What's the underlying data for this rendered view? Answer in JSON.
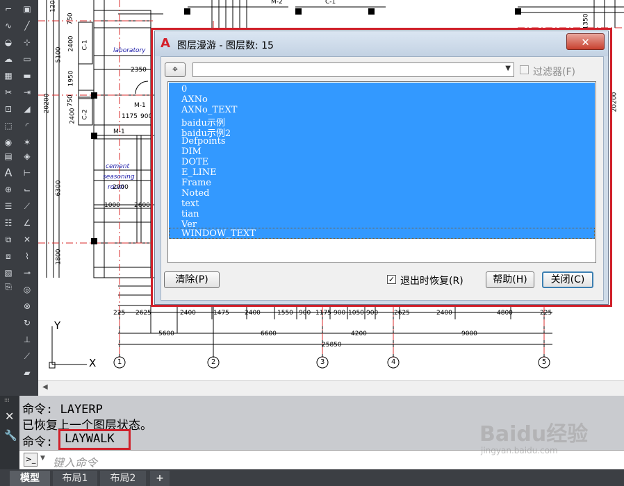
{
  "dialog": {
    "title": "图层漫游 - 图层数: 15",
    "close_glyph": "✕",
    "filter_label": "过滤器(F)",
    "filter_checked": false,
    "layers": [
      "0",
      "AXNo",
      "AXNo_TEXT",
      "baidu示例",
      "baidu示例2",
      "Defpoints",
      "DIM",
      "DOTE",
      "E_LINE",
      "Frame",
      "Noted",
      "text",
      "tian",
      "Ver",
      "WINDOW_TEXT"
    ],
    "clear_button": "清除(P)",
    "restore_label": "退出时恢复(R)",
    "restore_checked": true,
    "help_button": "帮助(H)",
    "close_button": "关闭(C)",
    "selection_color": "#3399ff"
  },
  "command": {
    "line1": "命令: LAYERP",
    "line2": "已恢复上一个图层状态。",
    "line3_prefix": "命令:",
    "line3_cmd": "LAYWALK",
    "input_placeholder": "键入命令"
  },
  "tabs": [
    "模型",
    "布局1",
    "布局2",
    "+"
  ],
  "drawing": {
    "room_labels": [
      "laboratory",
      "cement",
      "seasoning",
      "room"
    ],
    "door_labels": [
      "M-1",
      "M-1",
      "M-2",
      "C-1",
      "C-1",
      "C-2"
    ],
    "dims_left": [
      "120",
      "750",
      "2400",
      "5100",
      "1950",
      "20200",
      "750",
      "2400",
      "6300",
      "1800"
    ],
    "dims_small": [
      "2350",
      "1175",
      "900",
      "1000",
      "2600",
      "2000"
    ],
    "dims_row1": [
      "225",
      "2625",
      "2400",
      "1475",
      "2400",
      "1550",
      "900",
      "1175",
      "900",
      "1050",
      "900",
      "2625",
      "2400",
      "4800",
      "225"
    ],
    "dims_row2": [
      "5600",
      "6600",
      "4200",
      "9000"
    ],
    "dims_total": "25850",
    "axis_labels": [
      "1",
      "2",
      "3",
      "4",
      "5"
    ],
    "right_dims": [
      "1350",
      "20200"
    ],
    "ucs_x": "X",
    "ucs_y": "Y"
  },
  "watermark": {
    "brand": "Baidu经验",
    "url": "jingyan.baidu.com"
  }
}
